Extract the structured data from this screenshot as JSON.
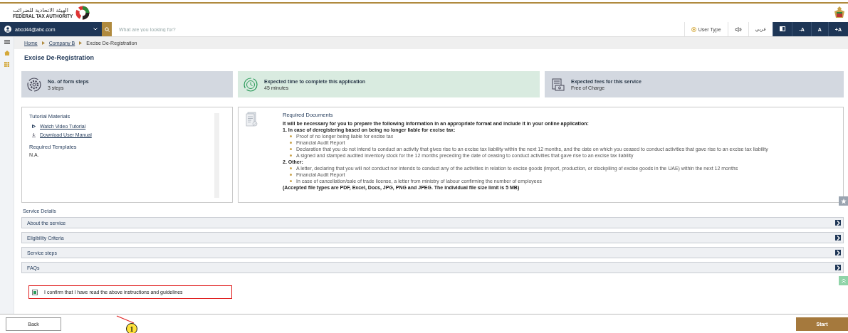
{
  "header": {
    "logo_arabic": "الهيئة الاتحادية للضرائب",
    "logo_english": "FEDERAL TAX AUTHORITY"
  },
  "navbar": {
    "user_email": "abcd44@abc.com",
    "search": {
      "placeholder": "What are you looking for?"
    },
    "user_type": "User Type",
    "language": "عربي",
    "font_buttons": [
      "-A",
      "A",
      "+A"
    ]
  },
  "breadcrumb": [
    {
      "label": "Home",
      "link": true
    },
    {
      "label": "Company B",
      "link": true
    },
    {
      "label": "Excise De-Registration",
      "link": false
    }
  ],
  "page_title": "Excise De-Registration",
  "info_cards": [
    {
      "kind": "steps",
      "title": "No. of form steps",
      "value": "3 steps",
      "highlighted": false
    },
    {
      "kind": "time",
      "title": "Expected time to complete this application",
      "value": "45 minutes",
      "highlighted": true
    },
    {
      "kind": "fees",
      "title": "Expected fees for this service",
      "value": "Free of Charge",
      "highlighted": false
    }
  ],
  "tutorial": {
    "title": "Tutorial Materials",
    "links": [
      {
        "kind": "video",
        "label": "Watch Video Tutorial"
      },
      {
        "kind": "download",
        "label": "Download User Manual"
      }
    ],
    "templates_title": "Required Templates",
    "templates_value": "N.A."
  },
  "required_documents": {
    "title": "Required Documents",
    "intro": "It will be necessary for you to prepare the following information in an appropriate format and include it in your online application:",
    "sections": [
      {
        "heading": "1. In case of deregistering based on being no longer liable for excise tax:",
        "items": [
          "Proof of no longer being liable for excise tax",
          "Financial Audit Report",
          "Declaration that you do not intend to conduct an activity that gives rise to an excise tax liability within the next 12 months, and the date on which you ceased to conduct activities that gave rise to an excise tax liability",
          "A signed and stamped audited inventory stock for the 12 months preceding the date of ceasing to conduct activities that gave rise to an excise tax liability"
        ]
      },
      {
        "heading": "2. Other:",
        "items": [
          "A letter, declaring that you will not conduct nor intends to conduct any of the activities in relation to excise goods (import, production, or stockpiling of excise goods in the UAE) within the next 12 months",
          "Financial Audit Report",
          "In case of cancellation/sale of trade license, a letter from ministry of labour confirming the number of employees"
        ]
      }
    ],
    "note": "(Accepted file types are PDF, Excel, Docs, JPG, PNG and JPEG. The individual file size limit is 5 MB)"
  },
  "service_details": {
    "title": "Service Details",
    "sections": [
      {
        "label": "About the service",
        "expanded": false
      },
      {
        "label": "Eligibility Criteria",
        "expanded": false
      },
      {
        "label": "Service steps",
        "expanded": false
      },
      {
        "label": "FAQs",
        "expanded": false
      }
    ]
  },
  "confirmation": {
    "label": "I confirm that I have read the above instructions and guidelines",
    "checked": true
  },
  "callout": "1",
  "footer": {
    "back": "Back",
    "start": "Start"
  }
}
